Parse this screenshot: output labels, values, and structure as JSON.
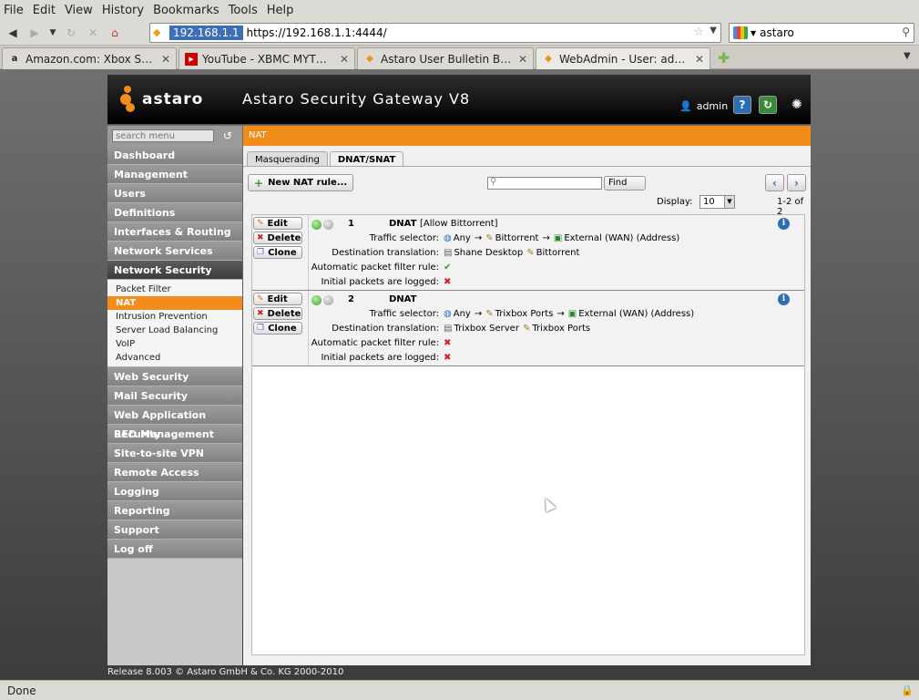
{
  "browser": {
    "menu": [
      "File",
      "Edit",
      "View",
      "History",
      "Bookmarks",
      "Tools",
      "Help"
    ],
    "url_host": "192.168.1.1",
    "url": "https://192.168.1.1:4444/",
    "search_value": "astaro",
    "tabs": [
      {
        "label": "Amazon.com: Xbox Stand...",
        "icon": "amazon-icon"
      },
      {
        "label": "YouTube - XBMC MYTHTV ...",
        "icon": "youtube-icon"
      },
      {
        "label": "Astaro User Bulletin Boar...",
        "icon": "astaro-icon"
      },
      {
        "label": "WebAdmin - User: admin - ...",
        "icon": "astaro-icon",
        "active": true
      }
    ],
    "status": "Done"
  },
  "header": {
    "logo_text": "astaro",
    "title": "Astaro Security Gateway V8",
    "user": "admin",
    "help_label": "?"
  },
  "sidebar": {
    "search_placeholder": "search menu",
    "items_top": [
      "Dashboard",
      "Management",
      "Users",
      "Definitions",
      "Interfaces & Routing",
      "Network Services"
    ],
    "open_item": "Network Security",
    "sub_items": [
      "Packet Filter",
      "NAT",
      "Intrusion Prevention",
      "Server Load Balancing",
      "VoIP",
      "Advanced"
    ],
    "selected_sub": 1,
    "items_bottom": [
      "Web Security",
      "Mail Security",
      "Web Application Security",
      "RED Management",
      "Site-to-site VPN",
      "Remote Access",
      "Logging",
      "Reporting",
      "Support",
      "Log off"
    ]
  },
  "content": {
    "page_title": "NAT",
    "tabs": [
      "Masquerading",
      "DNAT/SNAT"
    ],
    "selected_tab": 1,
    "new_rule_label": "New NAT rule...",
    "find_label": "Find",
    "display_label": "Display:",
    "display_value": "10",
    "count": "1-2 of 2",
    "buttons": {
      "edit": "Edit",
      "delete": "Delete",
      "clone": "Clone"
    },
    "labels": {
      "traffic": "Traffic selector:",
      "dest": "Destination translation:",
      "auto": "Automatic packet filter rule:",
      "logged": "Initial packets are logged:"
    },
    "rules": [
      {
        "num": "1",
        "type": "DNAT",
        "comment": "[Allow Bittorrent]",
        "src": "Any",
        "service": "Bittorrent",
        "dest": "External (WAN) (Address)",
        "trans_host": "Shane Desktop",
        "trans_service": "Bittorrent",
        "auto_rule": true,
        "logged": false
      },
      {
        "num": "2",
        "type": "DNAT",
        "comment": "",
        "src": "Any",
        "service": "Trixbox Ports",
        "dest": "External (WAN) (Address)",
        "trans_host": "Trixbox Server",
        "trans_service": "Trixbox Ports",
        "auto_rule": false,
        "logged": false
      }
    ]
  },
  "footer": {
    "release": "Release 8.003 © Astaro GmbH & Co. KG 2000-2010"
  },
  "colors": {
    "accent": "#f28c1a",
    "info": "#2d6db3"
  }
}
